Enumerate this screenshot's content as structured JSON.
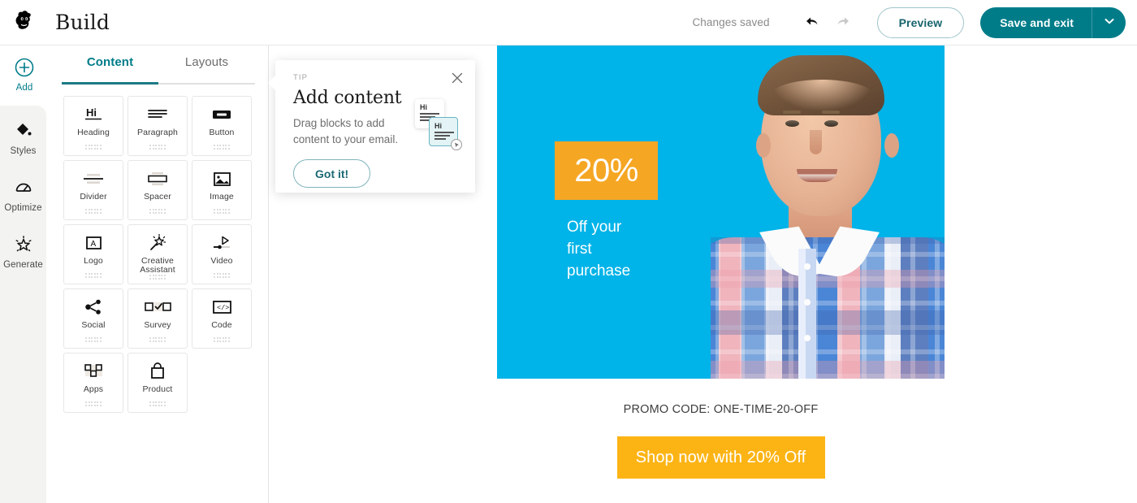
{
  "topbar": {
    "app_title": "Build",
    "logo_icon": "mailchimp-freddie-logo",
    "status_text": "Changes saved",
    "undo_icon": "undo-arrow-icon",
    "redo_icon": "redo-arrow-icon",
    "preview_label": "Preview",
    "save_label": "Save and exit",
    "save_caret_icon": "chevron-down-icon",
    "accent_color": "#007c89"
  },
  "rail": {
    "items": [
      {
        "label": "Add",
        "icon": "plus-circle-icon",
        "active": true
      },
      {
        "label": "Styles",
        "icon": "paint-diamond-icon",
        "active": false
      },
      {
        "label": "Optimize",
        "icon": "gauge-icon",
        "active": false
      },
      {
        "label": "Generate",
        "icon": "sparkle-star-icon",
        "active": false
      }
    ]
  },
  "panel": {
    "tabs": [
      {
        "label": "Content",
        "active": true
      },
      {
        "label": "Layouts",
        "active": false
      }
    ],
    "blocks": [
      {
        "label": "Heading",
        "icon": "heading-hi-icon"
      },
      {
        "label": "Paragraph",
        "icon": "paragraph-lines-icon"
      },
      {
        "label": "Button",
        "icon": "button-icon"
      },
      {
        "label": "Divider",
        "icon": "divider-icon"
      },
      {
        "label": "Spacer",
        "icon": "spacer-icon"
      },
      {
        "label": "Image",
        "icon": "image-icon"
      },
      {
        "label": "Logo",
        "icon": "logo-a-icon"
      },
      {
        "label": "Creative Assistant",
        "icon": "magic-wand-icon"
      },
      {
        "label": "Video",
        "icon": "video-play-icon"
      },
      {
        "label": "Social",
        "icon": "share-nodes-icon"
      },
      {
        "label": "Survey",
        "icon": "survey-checkbox-icon"
      },
      {
        "label": "Code",
        "icon": "code-brackets-icon"
      },
      {
        "label": "Apps",
        "icon": "apps-grid-icon"
      },
      {
        "label": "Product",
        "icon": "shopping-bag-icon"
      }
    ]
  },
  "tip": {
    "kicker": "TIP",
    "title": "Add content",
    "body": "Drag blocks to add content to your email.",
    "button_label": "Got it!",
    "close_icon": "close-icon",
    "illustration": {
      "card_text": "Hi",
      "badge_icon": "drag-cursor-icon"
    }
  },
  "email": {
    "hero": {
      "background_color": "#00b3e8",
      "badge_text": "20%",
      "badge_color": "#f5a623",
      "subtitle_line1": "Off your",
      "subtitle_line2": "first",
      "subtitle_line3": "purchase",
      "photo_alt": "smiling-man-in-plaid-shirt-photo"
    },
    "promo_code": "PROMO CODE: ONE-TIME-20-OFF",
    "cta_label": "Shop now with 20% Off",
    "cta_color": "#fcb415"
  }
}
